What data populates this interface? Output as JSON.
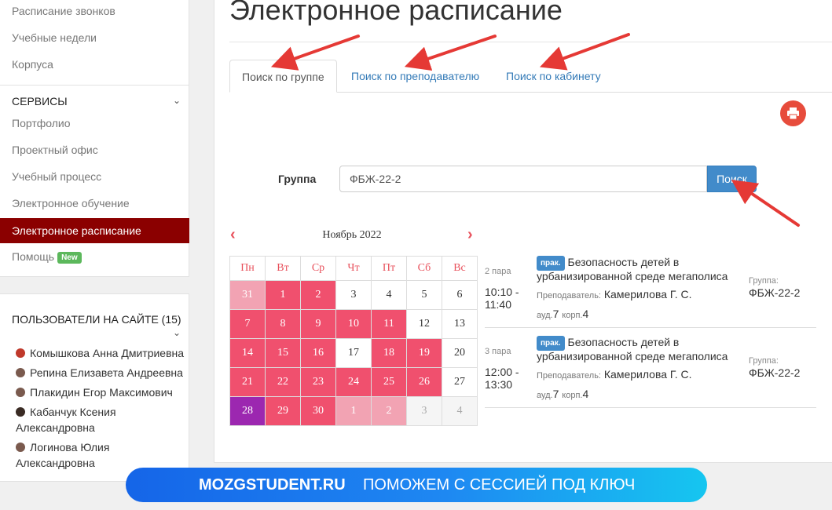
{
  "sidebar": {
    "nav": [
      "Расписание звонков",
      "Учебные недели",
      "Корпуса"
    ],
    "services_title": "СЕРВИСЫ",
    "services": [
      "Портфолио",
      "Проектный офис",
      "Учебный процесс",
      "Электронное обучение"
    ],
    "active_item": "Электронное расписание",
    "help_label": "Помощь",
    "help_badge": "New"
  },
  "users": {
    "title": "ПОЛЬЗОВАТЕЛИ НА САЙТЕ (15)",
    "list": [
      "Комышкова Анна Дмитриевна",
      "Репина Елизавета Андреевна",
      "Плакидин Егор Максимович",
      "Кабанчук Ксения Александровна",
      "Логинова Юлия Александровна"
    ]
  },
  "page": {
    "title": "Электронное расписание",
    "tabs": [
      "Поиск по группе",
      "Поиск по преподавателю",
      "Поиск по кабинету"
    ],
    "active_tab": 0,
    "print_icon": "printer-icon"
  },
  "search": {
    "label": "Группа",
    "value": "ФБЖ-22-2",
    "button": "Поиск"
  },
  "calendar": {
    "month": "Ноябрь 2022",
    "prev_icon": "chevron-left-icon",
    "next_icon": "chevron-right-icon",
    "weekdays": [
      "Пн",
      "Вт",
      "Ср",
      "Чт",
      "Пт",
      "Сб",
      "Вс"
    ],
    "weeks": [
      [
        "31",
        "1",
        "2",
        "3",
        "4",
        "5",
        "6"
      ],
      [
        "7",
        "8",
        "9",
        "10",
        "11",
        "12",
        "13"
      ],
      [
        "14",
        "15",
        "16",
        "17",
        "18",
        "19",
        "20"
      ],
      [
        "21",
        "22",
        "23",
        "24",
        "25",
        "26",
        "27"
      ],
      [
        "28",
        "29",
        "30",
        "1",
        "2",
        "3",
        "4"
      ]
    ],
    "colors": {
      "has_lessons": "#f0506e",
      "other_month_lessons": "#f2a3b3",
      "selected": "#9c27b0",
      "header": "#e8505b"
    }
  },
  "lessons": [
    {
      "num": "2 пара",
      "time_start": "10:10 -",
      "time_end": "11:40",
      "type": "прак.",
      "subject": "Безопасность детей в урбанизированной среде мегаполиса",
      "teacher_label": "Преподаватель:",
      "teacher": "Камерилова Г. С.",
      "room_label1": "ауд.",
      "room_num": "7",
      "room_label2": "корп.",
      "building": "4",
      "group_label": "Группа:",
      "group": "ФБЖ-22-2"
    },
    {
      "num": "3 пара",
      "time_start": "12:00 -",
      "time_end": "13:30",
      "type": "прак.",
      "subject": "Безопасность детей в урбанизированной среде мегаполиса",
      "teacher_label": "Преподаватель:",
      "teacher": "Камерилова Г. С.",
      "room_label1": "ауд.",
      "room_num": "7",
      "room_label2": "корп.",
      "building": "4",
      "group_label": "Группа:",
      "group": "ФБЖ-22-2"
    }
  ],
  "banner": {
    "brand": "MOZGSTUDENT.RU",
    "slogan": "ПОМОЖЕМ С СЕССИЕЙ ПОД КЛЮЧ"
  },
  "accent": {
    "active_nav": "#8b0000",
    "primary": "#428bca",
    "annotation_arrow": "#e53935"
  }
}
